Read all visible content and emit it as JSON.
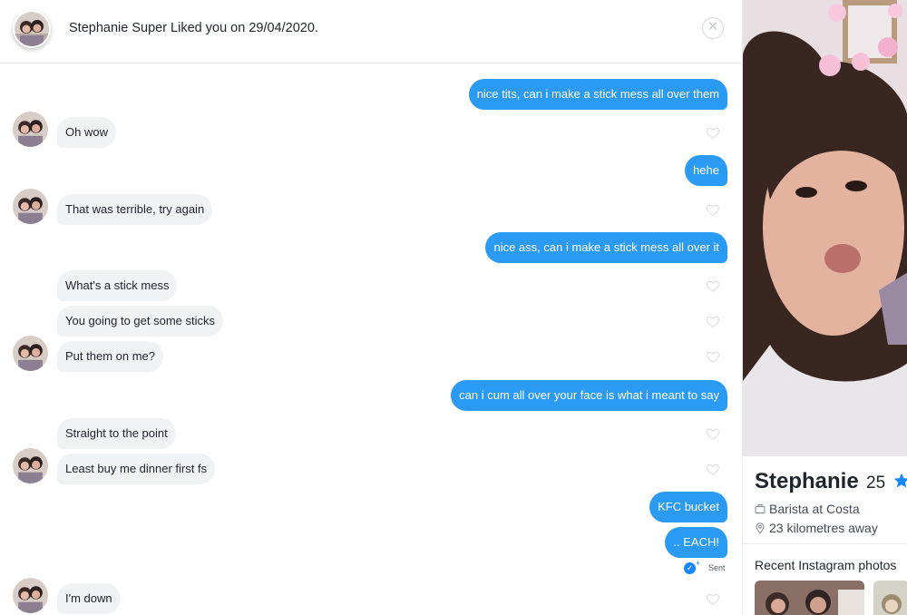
{
  "header": {
    "title": "Stephanie Super Liked you on 29/04/2020.",
    "close_symbol": "✕"
  },
  "messages": [
    {
      "dir": "out",
      "text": "nice tits, can i make a stick mess all over them"
    },
    {
      "dir": "in",
      "text": "Oh wow"
    },
    {
      "dir": "out",
      "text": "hehe"
    },
    {
      "dir": "in",
      "text": "That was terrible, try again"
    },
    {
      "dir": "out",
      "text": "nice ass, can i make a stick mess all over it"
    },
    {
      "dir": "in",
      "text": "What's a stick mess"
    },
    {
      "dir": "in",
      "text": "You going to get some sticks"
    },
    {
      "dir": "in",
      "text": "Put them on me?"
    },
    {
      "dir": "out",
      "text": "can i cum all over your face is what i meant to say"
    },
    {
      "dir": "in",
      "text": "Straight to the point"
    },
    {
      "dir": "in",
      "text": "Least buy me dinner first fs"
    },
    {
      "dir": "out",
      "text": "KFC bucket"
    },
    {
      "dir": "out",
      "text": ".. EACH!"
    },
    {
      "dir": "in",
      "text": "I'm down"
    }
  ],
  "sent_status": "Sent",
  "profile": {
    "name": "Stephanie",
    "age": "25",
    "job": "Barista at Costa",
    "distance": "23 kilometres away",
    "instagram_title": "Recent Instagram photos"
  },
  "colors": {
    "outgoing_bubble": "#2b9af3",
    "incoming_bubble": "#f0f2f4",
    "verified": "#1786ff"
  }
}
